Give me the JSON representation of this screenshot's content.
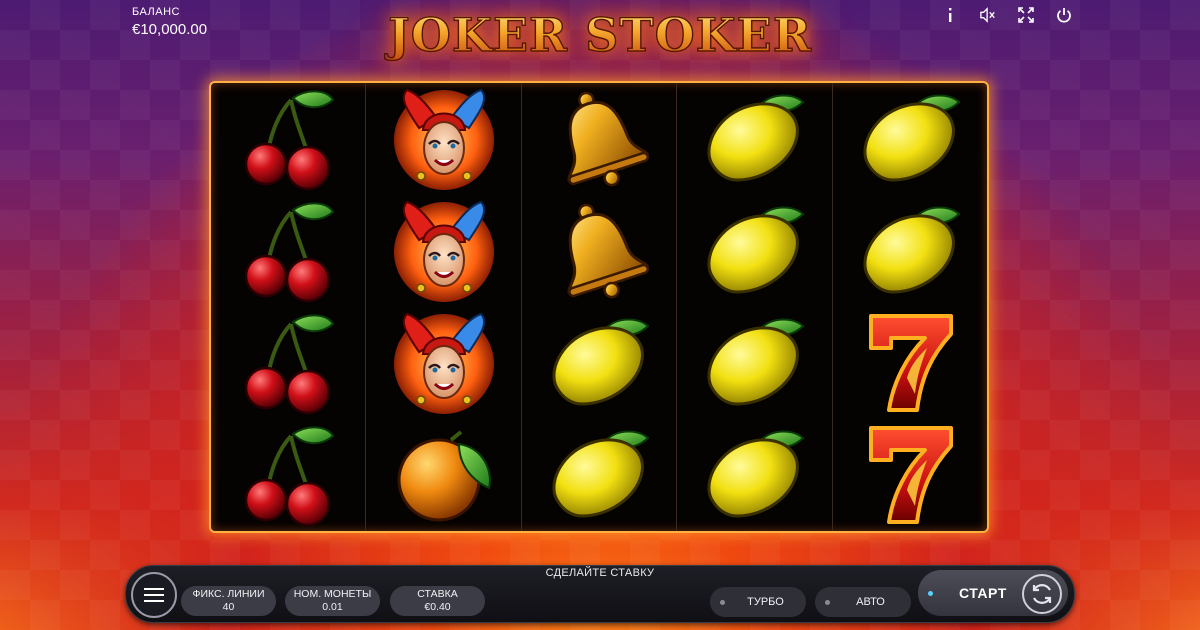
{
  "balance": {
    "label": "БАЛАНС",
    "value": "€10,000.00"
  },
  "logo": {
    "text": "JOKER STOKER"
  },
  "top_icons": [
    "info-icon",
    "sound-muted-icon",
    "fullscreen-icon",
    "power-icon"
  ],
  "reels": [
    [
      "cherry",
      "cherry",
      "cherry",
      "cherry"
    ],
    [
      "joker",
      "joker",
      "joker",
      "orange"
    ],
    [
      "bell",
      "bell",
      "lemon",
      "lemon"
    ],
    [
      "lemon",
      "lemon",
      "lemon",
      "lemon"
    ],
    [
      "lemon",
      "lemon",
      "seven",
      "seven"
    ]
  ],
  "controls": {
    "prompt": "СДЕЛАЙТЕ СТАВКУ",
    "lines": {
      "label": "ФИКС. ЛИНИИ",
      "value": "40"
    },
    "coin": {
      "label": "НОМ. МОНЕТЫ",
      "value": "0.01"
    },
    "bet": {
      "label": "СТАВКА",
      "value": "€0.40"
    },
    "turbo": "ТУРБО",
    "auto": "АВТО",
    "start": "СТАРТ"
  },
  "colors": {
    "frame_glow": "#ffb040",
    "start_indicator": "#5ad0ff"
  }
}
